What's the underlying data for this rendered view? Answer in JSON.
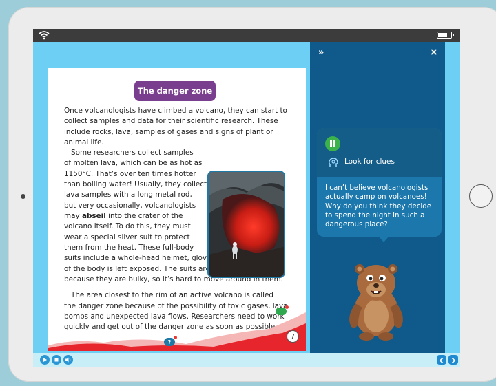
{
  "page": {
    "title": "The danger zone",
    "lines_intro": [
      "Once volcanologists have climbed a volcano, they can start to",
      "collect samples and data for their scientific research. These",
      "include rocks, lava, samples of gases and signs of plant or",
      "animal life."
    ],
    "lines_col": [
      "Some researchers collect samples",
      "of molten lava, which can be as hot as",
      "1150°C. That’s over ten times hotter",
      "than boiling water! Usually, they collect",
      "lava samples with a long metal rod,",
      "but very occasionally, volcanologists",
      "may",
      "abseil",
      "into the crater of the",
      "volcano itself. To do this, they must",
      "wear a special silver suit to protect",
      "them from the heat. These full-body"
    ],
    "lines_full": [
      "suits include a whole-head helmet, gloves and boots. No part",
      "of the body is left exposed. The suits aren’t used very often",
      "because they are bulky, so it’s hard to move around in them."
    ],
    "lines_para3": [
      "The area closest to the rim of an active volcano is called",
      "the danger zone because of the possibility of toxic gases, lava",
      "bombs and unexpected lava flows. Researchers need to work",
      "quickly and get out of the danger zone as soon as possible."
    ],
    "page_number": "7",
    "help_glyph": "?"
  },
  "panel": {
    "forward_glyph": "»",
    "close_glyph": "×",
    "clue_label": "Look for clues",
    "bubble_text": "I can’t believe volcanologists actually camp on volcanoes! Why do you think they decide to spend the night in such a dangerous place?"
  },
  "colors": {
    "accent_purple": "#7a3e8e",
    "panel_blue": "#0f5a8a",
    "play_blue": "#2a97d4",
    "pause_green": "#3bb34a"
  }
}
